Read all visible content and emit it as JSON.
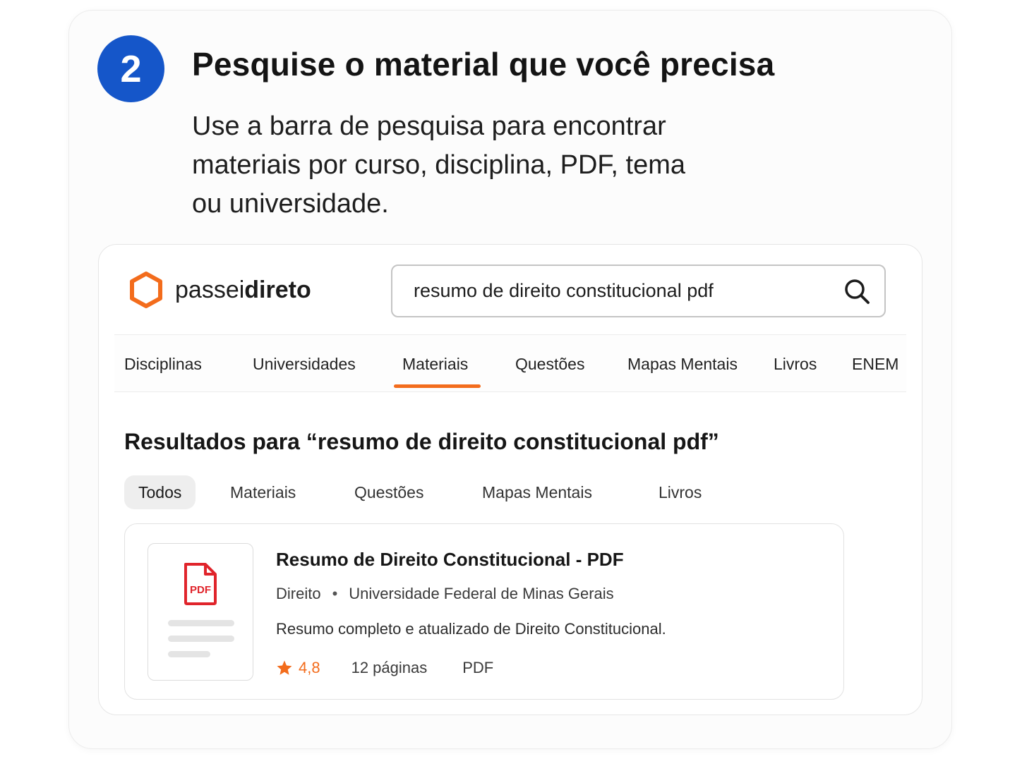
{
  "step": {
    "number": "2",
    "title": "Pesquise o material que você precisa",
    "description_lines": [
      "Use a barra de pesquisa para encontrar",
      "materiais por curso, disciplina, PDF, tema",
      "ou universidade."
    ]
  },
  "logo": {
    "prefix": "passei",
    "bold": "direto",
    "icon": "hexagon-logo-icon",
    "color": "#f36c1c"
  },
  "search": {
    "value": "resumo de direito constitucional pdf",
    "icon": "search-icon"
  },
  "nav": {
    "items": [
      "Disciplinas",
      "Universidades",
      "Materiais",
      "Questões",
      "Mapas Mentais",
      "Livros",
      "ENEM"
    ],
    "active": "Materiais",
    "accent": "#f36c1c"
  },
  "results": {
    "title": "Resultados para “resumo de direito constitucional pdf”",
    "filters": [
      "Todos",
      "Materiais",
      "Questões",
      "Mapas Mentais",
      "Livros"
    ],
    "active_filter": "Todos"
  },
  "result": {
    "badge": "PDF",
    "title": "Resumo de Direito Constitucional - PDF",
    "subject": "Direito",
    "separator": "•",
    "university": "Universidade Federal de Minas Gerais",
    "description": "Resumo completo e atualizado de Direito Constitucional.",
    "rating": "4,8",
    "pages": "12 páginas",
    "format": "PDF"
  },
  "colors": {
    "step_badge": "#1556c9",
    "pdf_red": "#e0242b",
    "accent": "#f36c1c"
  }
}
